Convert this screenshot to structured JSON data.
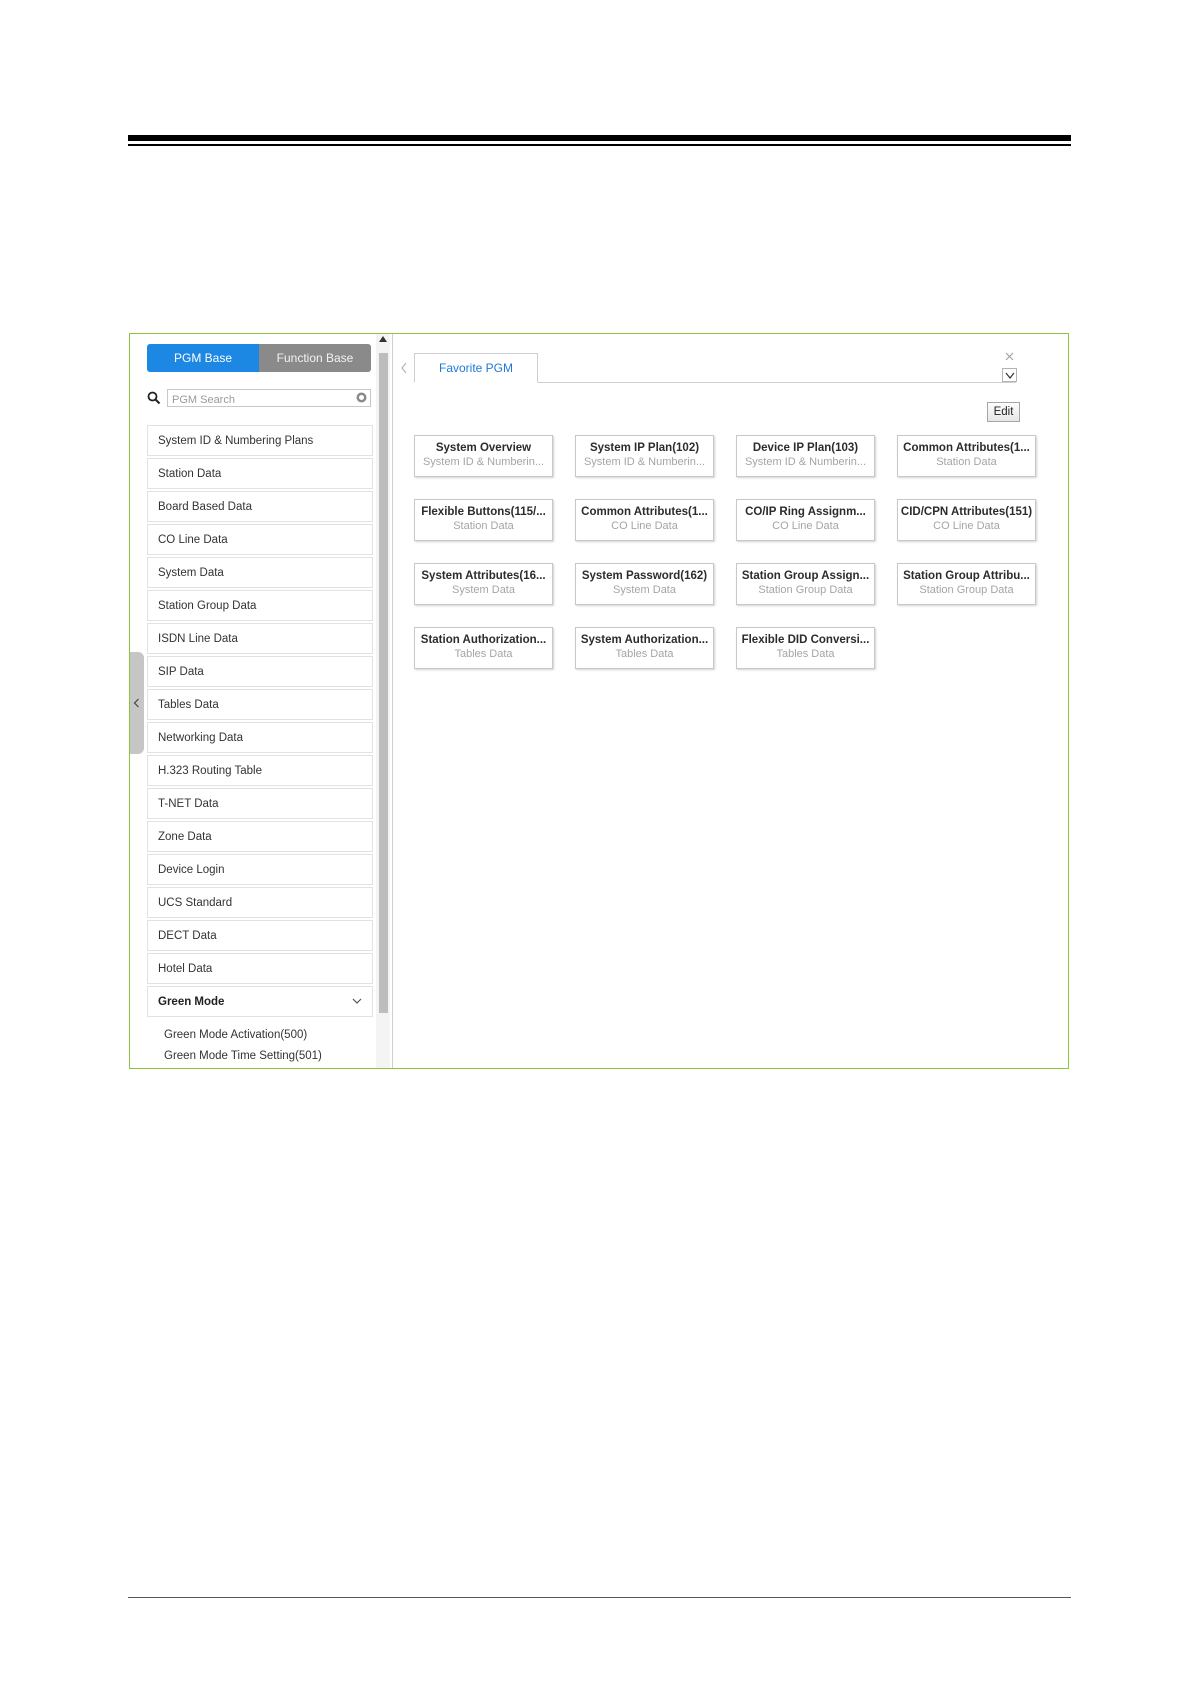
{
  "sidebar": {
    "tabs": {
      "pgm": "PGM Base",
      "function": "Function Base"
    },
    "search": {
      "placeholder": "PGM Search"
    },
    "items": [
      "System ID & Numbering Plans",
      "Station Data",
      "Board Based Data",
      "CO Line Data",
      "System Data",
      "Station Group Data",
      "ISDN Line Data",
      "SIP Data",
      "Tables Data",
      "Networking Data",
      "H.323 Routing Table",
      "T-NET Data",
      "Zone Data",
      "Device Login",
      "UCS Standard",
      "DECT Data",
      "Hotel Data"
    ],
    "expanded": {
      "label": "Green Mode",
      "children": [
        "Green Mode Activation(500)",
        "Green Mode Time Setting(501)"
      ]
    }
  },
  "main": {
    "tab_label": "Favorite PGM",
    "edit_label": "Edit",
    "cards": [
      {
        "title": "System Overview",
        "subtitle": "System ID & Numberin..."
      },
      {
        "title": "System IP Plan(102)",
        "subtitle": "System ID & Numberin..."
      },
      {
        "title": "Device IP Plan(103)",
        "subtitle": "System ID & Numberin..."
      },
      {
        "title": "Common Attributes(1...",
        "subtitle": "Station Data"
      },
      {
        "title": "Flexible Buttons(115/...",
        "subtitle": "Station Data"
      },
      {
        "title": "Common Attributes(1...",
        "subtitle": "CO Line Data"
      },
      {
        "title": "CO/IP Ring Assignm...",
        "subtitle": "CO Line Data"
      },
      {
        "title": "CID/CPN Attributes(151)",
        "subtitle": "CO Line Data"
      },
      {
        "title": "System Attributes(16...",
        "subtitle": "System Data"
      },
      {
        "title": "System Password(162)",
        "subtitle": "System Data"
      },
      {
        "title": "Station Group Assign...",
        "subtitle": "Station Group Data"
      },
      {
        "title": "Station Group Attribu...",
        "subtitle": "Station Group Data"
      },
      {
        "title": "Station Authorization...",
        "subtitle": "Tables Data"
      },
      {
        "title": "System Authorization...",
        "subtitle": "Tables Data"
      },
      {
        "title": "Flexible DID Conversi...",
        "subtitle": "Tables Data"
      }
    ]
  },
  "icons": {
    "search": "search-icon",
    "clear": "clear-icon",
    "collapse": "chevron-left-icon",
    "tab_prev": "chevron-left-icon",
    "close": "close-icon",
    "dropdown": "chevron-down-icon",
    "expand": "chevron-down-icon"
  },
  "colors": {
    "accent": "#1d87e4",
    "frame": "#8cc63f",
    "inactive_tab": "#8a8a8a"
  }
}
